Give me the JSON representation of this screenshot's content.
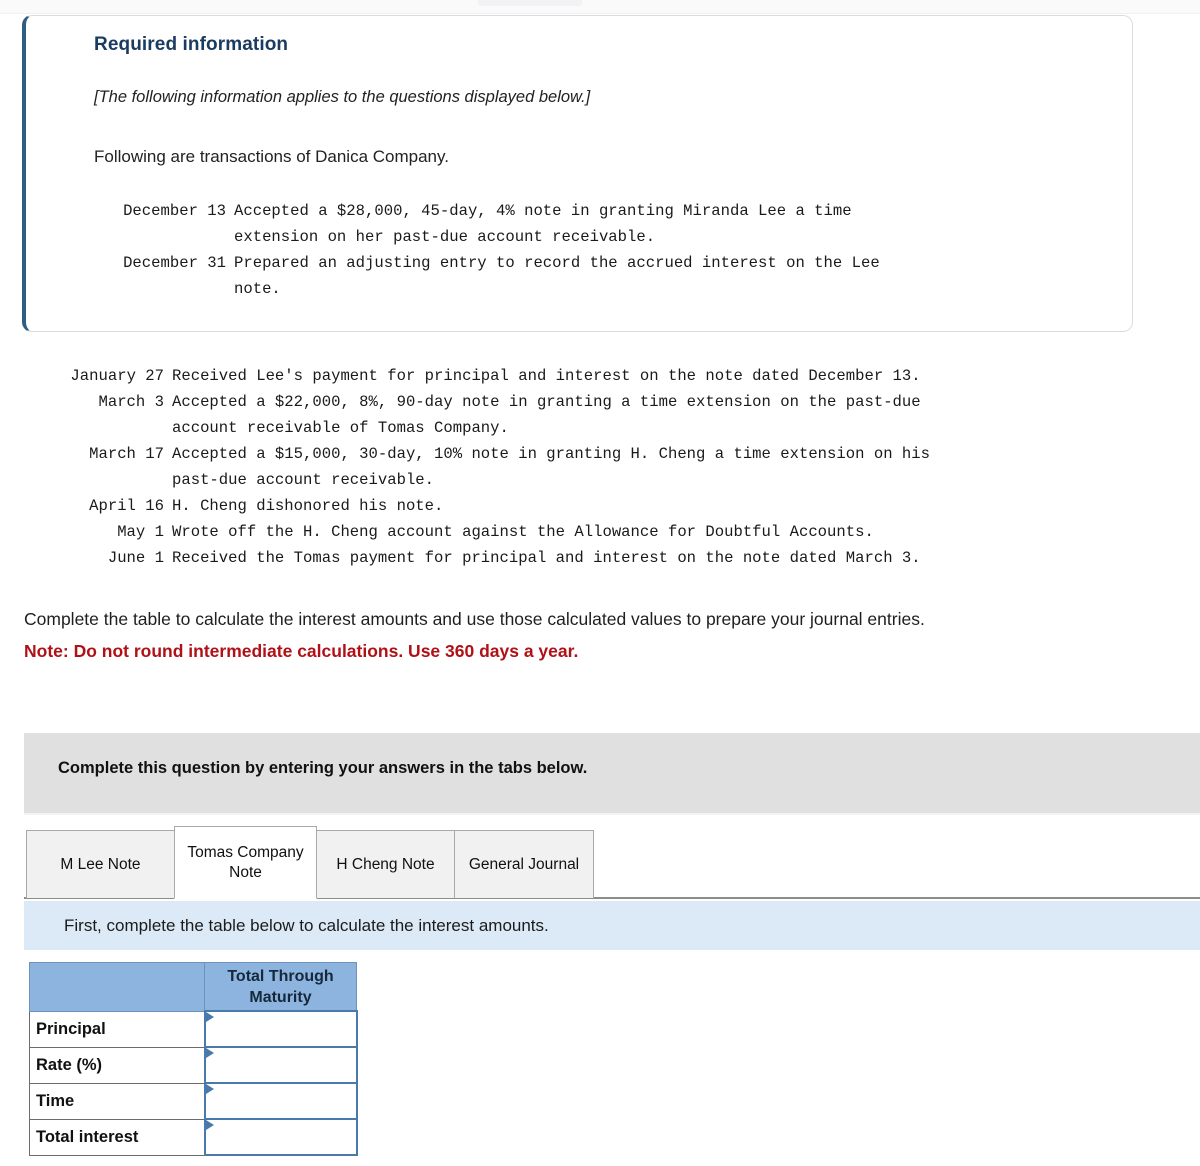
{
  "required_panel": {
    "title": "Required information",
    "applies_note": "[The following information applies to the questions displayed below.]",
    "lead": "Following are transactions of Danica Company.",
    "transactions": [
      {
        "date": "December 13",
        "lines": [
          "Accepted a $28,000, 45-day, 4% note in granting Miranda Lee a time",
          "extension on her past-due account receivable."
        ]
      },
      {
        "date": "December 31",
        "lines": [
          "Prepared an adjusting entry to record the accrued interest on the Lee",
          "note."
        ]
      }
    ]
  },
  "transactions_continued": [
    {
      "date": "January 27",
      "lines": [
        "Received Lee's payment for principal and interest on the note dated December 13."
      ]
    },
    {
      "date": "March 3",
      "lines": [
        "Accepted a $22,000, 8%, 90-day note in granting a time extension on the past-due",
        "account receivable of Tomas Company."
      ]
    },
    {
      "date": "March 17",
      "lines": [
        "Accepted a $15,000, 30-day, 10% note in granting H. Cheng a time extension on his",
        "past-due account receivable."
      ]
    },
    {
      "date": "April 16",
      "lines": [
        "H. Cheng dishonored his note."
      ]
    },
    {
      "date": "May 1",
      "lines": [
        "Wrote off the H. Cheng account against the Allowance for Doubtful Accounts."
      ]
    },
    {
      "date": "June 1",
      "lines": [
        "Received the Tomas payment for principal and interest on the note dated March 3."
      ]
    }
  ],
  "instructions": {
    "body": "Complete the table to calculate the interest amounts and use those calculated values to prepare your journal entries.",
    "note": "Note: Do not round intermediate calculations. Use 360 days a year."
  },
  "grey_banner": {
    "text": "Complete this question by entering your answers in the tabs below."
  },
  "tabs": [
    {
      "label": "M Lee Note",
      "active": false
    },
    {
      "label": "Tomas Company Note",
      "active": true
    },
    {
      "label": "H Cheng Note",
      "active": false
    },
    {
      "label": "General Journal",
      "active": false
    }
  ],
  "blue_banner": {
    "text": "First, complete the table below to calculate the interest amounts."
  },
  "calc_table": {
    "header_blank": "",
    "header_col": "Total Through Maturity",
    "rows": [
      {
        "label": "Principal",
        "value": ""
      },
      {
        "label": "Rate (%)",
        "value": ""
      },
      {
        "label": "Time",
        "value": ""
      },
      {
        "label": "Total interest",
        "value": ""
      }
    ]
  },
  "colors": {
    "panel_accent": "#2e5e82",
    "title_blue": "#1b3c61",
    "note_red": "#b01117",
    "grey_banner": "#e0e0e0",
    "blue_banner": "#dceaf7",
    "table_header_blue": "#8cb4de",
    "input_border_blue": "#4a7aac"
  }
}
